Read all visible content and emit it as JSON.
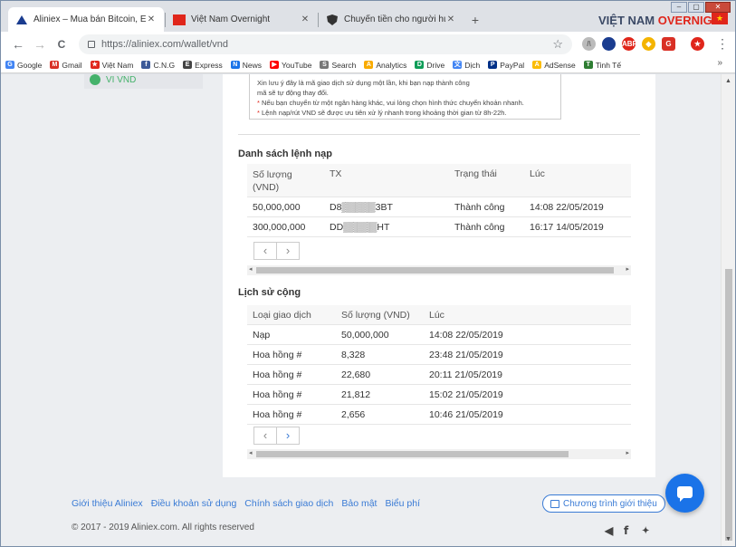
{
  "browser": {
    "tabs": [
      {
        "title": "Aliniex – Mua bán Bitcoin, Ethere",
        "active": true
      },
      {
        "title": "Việt Nam Overnight",
        "active": false
      },
      {
        "title": "Chuyển tiền cho người hưởng tạ",
        "active": false
      }
    ],
    "new_tab": "+",
    "brand_part1": "VIỆT NAM ",
    "brand_part2": "OVERNIGHT",
    "url": "https://aliniex.com/wallet/vnd",
    "window_controls": {
      "minimize": "–",
      "maximize": "▢",
      "close": "✕"
    },
    "nav": {
      "back": "←",
      "forward": "→",
      "reload": "C"
    },
    "star": "☆",
    "menu": "⋮"
  },
  "bookmarks": [
    {
      "label": "Google",
      "icon_color": "#4285f4",
      "icon": "G"
    },
    {
      "label": "Gmail",
      "icon_color": "#d93025",
      "icon": "M"
    },
    {
      "label": "Việt Nam",
      "icon_color": "#e0261b",
      "icon": "★"
    },
    {
      "label": "C.N.G",
      "icon_color": "#3b5998",
      "icon": "f"
    },
    {
      "label": "Express",
      "icon_color": "#444444",
      "icon": "E"
    },
    {
      "label": "News",
      "icon_color": "#1a73e8",
      "icon": "N"
    },
    {
      "label": "YouTube",
      "icon_color": "#ff0000",
      "icon": "▶"
    },
    {
      "label": "Search",
      "icon_color": "#777777",
      "icon": "S"
    },
    {
      "label": "Analytics",
      "icon_color": "#f9ab00",
      "icon": "A"
    },
    {
      "label": "Drive",
      "icon_color": "#0f9d58",
      "icon": "D"
    },
    {
      "label": "Dịch",
      "icon_color": "#4285f4",
      "icon": "文"
    },
    {
      "label": "PayPal",
      "icon_color": "#003087",
      "icon": "P"
    },
    {
      "label": "AdSense",
      "icon_color": "#fbbc04",
      "icon": "A"
    },
    {
      "label": "Tinh Tế",
      "icon_color": "#2e7d32",
      "icon": "T"
    }
  ],
  "bookmarks_more": "»",
  "sidebar": {
    "active_item": "VI VND"
  },
  "notes": {
    "line1": "Xin lưu ý đây là mã giao dịch sử dụng một lần, khi bạn nạp thành công",
    "line2": "mã sẽ tự động thay đổi.",
    "line3": "Nếu bạn chuyển từ một ngân hàng khác, vui lòng chọn hình thức chuyển khoản nhanh.",
    "line4": "Lệnh nạp/rút VND sẽ được ưu tiên xử lý nhanh trong khoảng thời gian từ 8h-22h.",
    "bullet": "*"
  },
  "deposit_orders": {
    "title": "Danh sách lệnh nạp",
    "headers": {
      "amount": "Số lượng",
      "amount_unit": "(VND)",
      "tx": "TX",
      "status": "Trạng thái",
      "time": "Lúc"
    },
    "rows": [
      {
        "amount": "50,000,000",
        "tx": "D8▒▒▒▒▒3BT",
        "status": "Thành công",
        "time": "14:08 22/05/2019"
      },
      {
        "amount": "300,000,000",
        "tx": "DD▒▒▒▒▒HT",
        "status": "Thành công",
        "time": "16:17 14/05/2019"
      }
    ],
    "pager": {
      "prev": "‹",
      "next": "›"
    }
  },
  "commission_history": {
    "title": "Lịch sử cộng",
    "headers": {
      "type": "Loại giao dịch",
      "amount": "Số lượng (VND)",
      "time": "Lúc"
    },
    "rows": [
      {
        "type": "Nạp",
        "amount": "50,000,000",
        "time": "14:08 22/05/2019"
      },
      {
        "type": "Hoa hồng #",
        "amount": "8,328",
        "time": "23:48 21/05/2019"
      },
      {
        "type": "Hoa hồng #",
        "amount": "22,680",
        "time": "20:11 21/05/2019"
      },
      {
        "type": "Hoa hồng #",
        "amount": "21,812",
        "time": "15:02 21/05/2019"
      },
      {
        "type": "Hoa hồng #",
        "amount": "2,656",
        "time": "10:46 21/05/2019"
      }
    ],
    "pager": {
      "prev": "‹",
      "next": "›"
    }
  },
  "footer": {
    "links": [
      "Giới thiệu Aliniex",
      "Điều khoản sử dụng",
      "Chính sách giao dịch",
      "Bảo mật",
      "Biểu phí"
    ],
    "promo": "Chương trình giới thiệu",
    "copyright": "© 2017 - 2019 Aliniex.com. All rights reserved",
    "social": {
      "telegram": "◀",
      "facebook": "f",
      "twitter": "🐦"
    }
  },
  "colors": {
    "link": "#3a7bd5",
    "success_green": "#45b26b",
    "accent_red": "#e0261b",
    "chat_blue": "#1a73e8"
  }
}
